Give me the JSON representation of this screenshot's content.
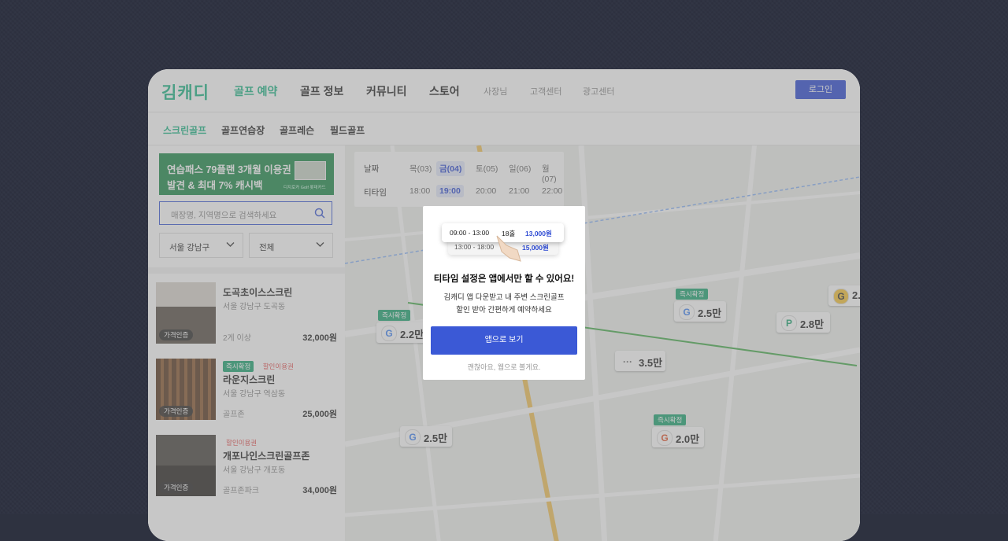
{
  "header": {
    "logo": "김캐디",
    "nav": [
      "골프 예약",
      "골프 정보",
      "커뮤니티",
      "스토어"
    ],
    "subnav": [
      "사장님",
      "고객센터",
      "광고센터"
    ],
    "login": "로그인"
  },
  "tabs": [
    "스크린골프",
    "골프연습장",
    "골프레슨",
    "필드골프"
  ],
  "banner": {
    "line1": "연습패스 79플랜 3개월 이용권",
    "line2": "발견 & 최대 7% 캐시백",
    "brand": "디지로카 Golf  롯데카드"
  },
  "search": {
    "placeholder": "매장명, 지역명으로 검색하세요"
  },
  "filters": {
    "region": "서울  강남구",
    "type": "전체"
  },
  "stores": [
    {
      "name": "도곡초이스스크린",
      "location": "서울 강남구 도곡동",
      "note": "2게 이상",
      "price": "32,000원",
      "badge": "가격인증",
      "tags": []
    },
    {
      "name": "라운지스크린",
      "location": "서울 강남구 역삼동",
      "note": "골프존",
      "price": "25,000원",
      "badge": "가격인증",
      "tags": [
        "즉시확정",
        "할인이용권"
      ]
    },
    {
      "name": "개포나인스크린골프존",
      "location": "서울 강남구 개포동",
      "note": "골프존파크",
      "price": "34,000원",
      "badge": "가격인증",
      "tags": [
        "할인이용권"
      ]
    }
  ],
  "datebar": {
    "date_label": "날짜",
    "time_label": "티타임",
    "dates": [
      "목(03)",
      "금(04)",
      "토(05)",
      "일(06)",
      "월(07)"
    ],
    "times": [
      "18:00",
      "19:00",
      "20:00",
      "21:00",
      "22:00"
    ]
  },
  "markers": [
    {
      "price": "2.2만",
      "fast": "즉시확정"
    },
    {
      "price": "2.5만",
      "fast": "즉시확정"
    },
    {
      "price": "2.8만"
    },
    {
      "price": "3.5만"
    },
    {
      "price": "2.0만",
      "fast": "즉시확정"
    },
    {
      "price": "2.5만"
    },
    {
      "price": "2."
    }
  ],
  "modal": {
    "card1_time": "09:00 - 13:00",
    "card1_holes": "18홀",
    "card1_price": "13,000원",
    "card2_time": "13:00 - 18:00",
    "card2_price": "15,000원",
    "title": "티타임 설정은 앱에서만 할 수 있어요!",
    "desc1": "김캐디 앱 다운받고 내 주변 스크린골프",
    "desc2": "할인 받아 간편하게 예약하세요",
    "button": "앱으로 보기",
    "skip": "괜찮아요, 웹으로 볼게요."
  },
  "colors": {
    "brand": "#1fb787",
    "primary": "#3b59d6"
  }
}
